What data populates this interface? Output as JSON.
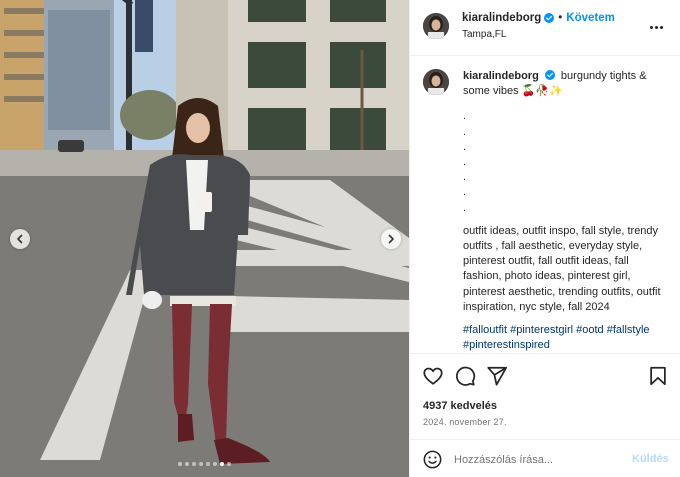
{
  "post": {
    "username": "kiaralindeborg",
    "follow_label": "Követem",
    "separator": "•",
    "location": "Tampa,FL",
    "caption_text": "burgundy tights & some vibes 🍒🥀✨",
    "caption_dots": [
      ".",
      ".",
      ".",
      ".",
      ".",
      ".",
      "."
    ],
    "caption_tags": "outfit ideas, outfit inspo, fall style, trendy outfits , fall aesthetic, everyday style, pinterest outfit, fall outfit ideas, fall fashion, photo ideas, pinterest girl, pinterest aesthetic, trending outfits, outfit inspiration, nyc style, fall 2024",
    "hashtags": [
      "#falloutfit",
      "#pinterestgirl",
      "#ootd",
      "#fallstyle",
      "#pinterestinspired"
    ],
    "likes_text": "4937 kedvelés",
    "date_text": "2024. november 27."
  },
  "comment_box": {
    "placeholder": "Hozzászólás írása...",
    "post_label": "Küldés"
  },
  "carousel": {
    "slide_count": 8,
    "active_index": 6
  },
  "colors": {
    "accent_blue": "#0095f6",
    "hashtag_blue": "#00376b",
    "disabled_blue": "#b3dbff",
    "muted_text": "#737373",
    "verified_blue": "#0095f6"
  },
  "icons": {
    "verified": "verified-badge-icon",
    "more": "more-options-icon",
    "like": "heart-icon",
    "comment": "comment-bubble-icon",
    "share": "paper-plane-icon",
    "save": "bookmark-icon",
    "emoji": "smiley-icon",
    "prev": "chevron-left-icon",
    "next": "chevron-right-icon"
  }
}
